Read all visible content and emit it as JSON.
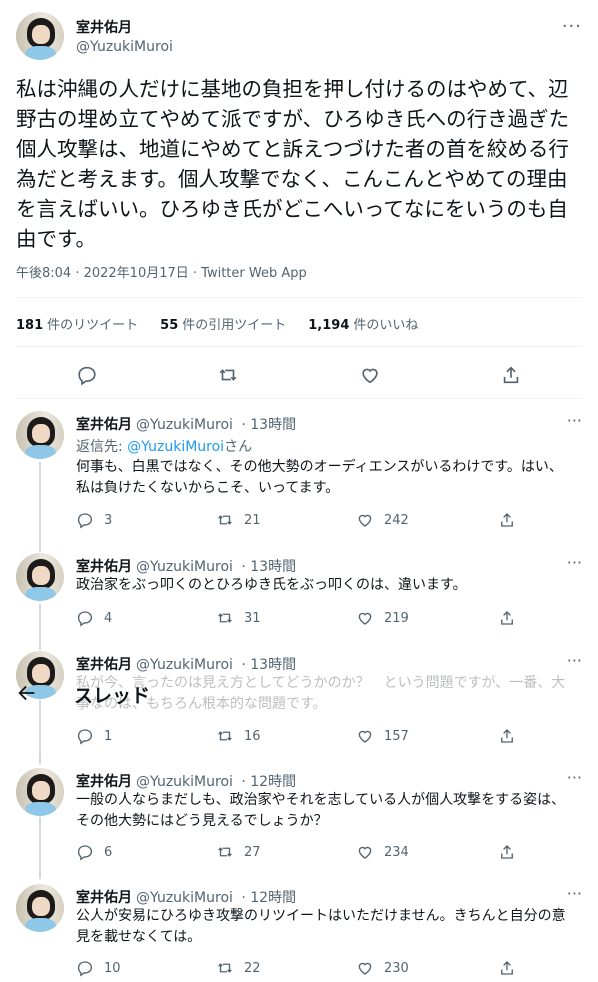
{
  "main": {
    "author_name": "室井佑月",
    "author_handle": "@YuzukiMuroi",
    "more": "···",
    "text": "私は沖縄の人だけに基地の負担を押し付けるのはやめて、辺野古の埋め立てやめて派ですが、ひろゆき氏への行き過ぎた個人攻撃は、地道にやめてと訴えつづけた者の首を絞める行為だと考えます。個人攻撃でなく、こんこんとやめての理由を言えばいい。ひろゆき氏がどこへいってなにをいうのも自由です。",
    "meta": "午後8:04 · 2022年10月17日 · Twitter Web App",
    "stats": {
      "retweets_count": "181",
      "retweets_label": "件のリツイート",
      "quotes_count": "55",
      "quotes_label": "件の引用ツイート",
      "likes_count": "1,194",
      "likes_label": "件のいいね"
    }
  },
  "floating_header": {
    "title": "スレッド"
  },
  "replies": [
    {
      "name": "室井佑月",
      "handle": "@YuzukiMuroi",
      "time": "· 13時間",
      "reply_to_prefix": "返信先: ",
      "reply_to_mention": "@YuzukiMuroi",
      "reply_to_suffix": "さん",
      "text": "何事も、白黒ではなく、その他大勢のオーディエンスがいるわけです。はい、私は負けたくないからこそ、いってます。",
      "replies": "3",
      "retweets": "21",
      "likes": "242"
    },
    {
      "name": "室井佑月",
      "handle": "@YuzukiMuroi",
      "time": "· 13時間",
      "text": "政治家をぶっ叩くのとひろゆき氏をぶっ叩くのは、違います。",
      "replies": "4",
      "retweets": "31",
      "likes": "219"
    },
    {
      "name": "室井佑月",
      "handle": "@YuzukiMuroi",
      "time": "· 13時間",
      "text": "私が今、言ったのは見え方としてどうかのか？　という問題ですが、一番、大事なのは、もちろん根本的な問題です。",
      "replies": "1",
      "retweets": "16",
      "likes": "157"
    },
    {
      "name": "室井佑月",
      "handle": "@YuzukiMuroi",
      "time": "· 12時間",
      "text": "一般の人ならまだしも、政治家やそれを志している人が個人攻撃をする姿は、その他大勢にはどう見えるでしょうか？",
      "replies": "6",
      "retweets": "27",
      "likes": "234"
    },
    {
      "name": "室井佑月",
      "handle": "@YuzukiMuroi",
      "time": "· 12時間",
      "text": "公人が安易にひろゆき攻撃のリツイートはいただけません。きちんと自分の意見を載せなくては。",
      "replies": "10",
      "retweets": "22",
      "likes": "230"
    }
  ],
  "colors": {
    "text": "#0f1419",
    "secondary": "#536471",
    "link": "#1d9bf0",
    "divider": "#eff3f4",
    "thread_line": "#cfd9de"
  }
}
